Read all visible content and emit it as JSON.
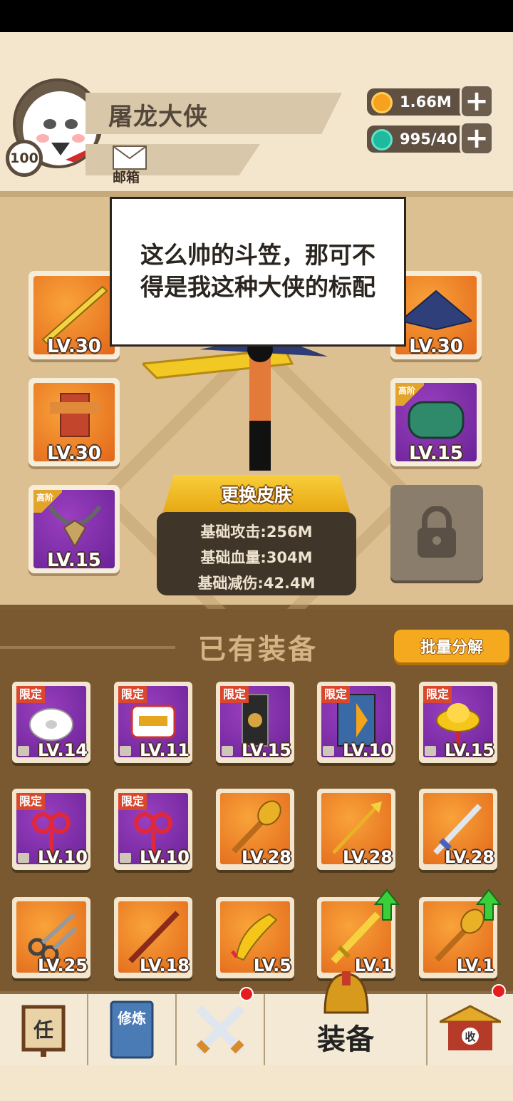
{
  "player": {
    "name": "屠龙大侠",
    "level": "100",
    "mail_label": "邮箱"
  },
  "currency": {
    "coins": "1.66M",
    "gems": "995/40"
  },
  "speech": {
    "line1": "这么帅的斗笠，那可不",
    "line2": "得是我这种大侠的标配"
  },
  "equipped": [
    {
      "slot": "weapon",
      "level": "LV.30",
      "tier": ""
    },
    {
      "slot": "hat",
      "level": "LV.30",
      "tier": ""
    },
    {
      "slot": "armor",
      "level": "LV.30",
      "tier": ""
    },
    {
      "slot": "bracer",
      "level": "LV.15",
      "tier": "高阶"
    },
    {
      "slot": "necklace",
      "level": "LV.15",
      "tier": "高阶"
    }
  ],
  "skin_button": "更换皮肤",
  "stats": {
    "attack": "基础攻击:256M",
    "hp": "基础血量:304M",
    "reduction": "基础减伤:42.4M"
  },
  "owned": {
    "title": "已有装备",
    "bulk_button": "批量分解",
    "limited_label": "限定",
    "items": [
      {
        "name": "toilet-paper",
        "level": "LV.14",
        "limited": true,
        "color": "purple"
      },
      {
        "name": "noodle-cup",
        "level": "LV.11",
        "limited": true,
        "color": "purple"
      },
      {
        "name": "banner-scroll",
        "level": "LV.15",
        "limited": true,
        "color": "purple"
      },
      {
        "name": "comic-book",
        "level": "LV.10",
        "limited": true,
        "color": "purple"
      },
      {
        "name": "gold-ingot",
        "level": "LV.15",
        "limited": true,
        "color": "purple"
      },
      {
        "name": "chinese-knot",
        "level": "LV.10",
        "limited": true,
        "color": "purple"
      },
      {
        "name": "chinese-knot",
        "level": "LV.10",
        "limited": true,
        "color": "purple"
      },
      {
        "name": "golden-mace",
        "level": "LV.28",
        "limited": false,
        "color": "orange"
      },
      {
        "name": "golden-spear",
        "level": "LV.28",
        "limited": false,
        "color": "orange"
      },
      {
        "name": "silver-sword",
        "level": "LV.28",
        "limited": false,
        "color": "orange"
      },
      {
        "name": "scissors",
        "level": "LV.25",
        "limited": false,
        "color": "orange"
      },
      {
        "name": "wooden-staff",
        "level": "LV.18",
        "limited": false,
        "color": "orange"
      },
      {
        "name": "rubber-chicken",
        "level": "LV.5",
        "limited": false,
        "color": "orange"
      },
      {
        "name": "golden-sword",
        "level": "LV.1",
        "limited": false,
        "color": "orange",
        "upgrade": true
      },
      {
        "name": "golden-mace",
        "level": "LV.1",
        "limited": false,
        "color": "orange",
        "upgrade": true
      }
    ]
  },
  "nav": {
    "task_glyph": "任",
    "practice_glyph": "修炼",
    "equip_label": "装备",
    "shop_glyph": "收"
  },
  "colors": {
    "orange_tile": "#e2671a",
    "purple_tile": "#6a2396",
    "button_gold": "#f5a91f",
    "brown_bg": "#7a5930"
  }
}
